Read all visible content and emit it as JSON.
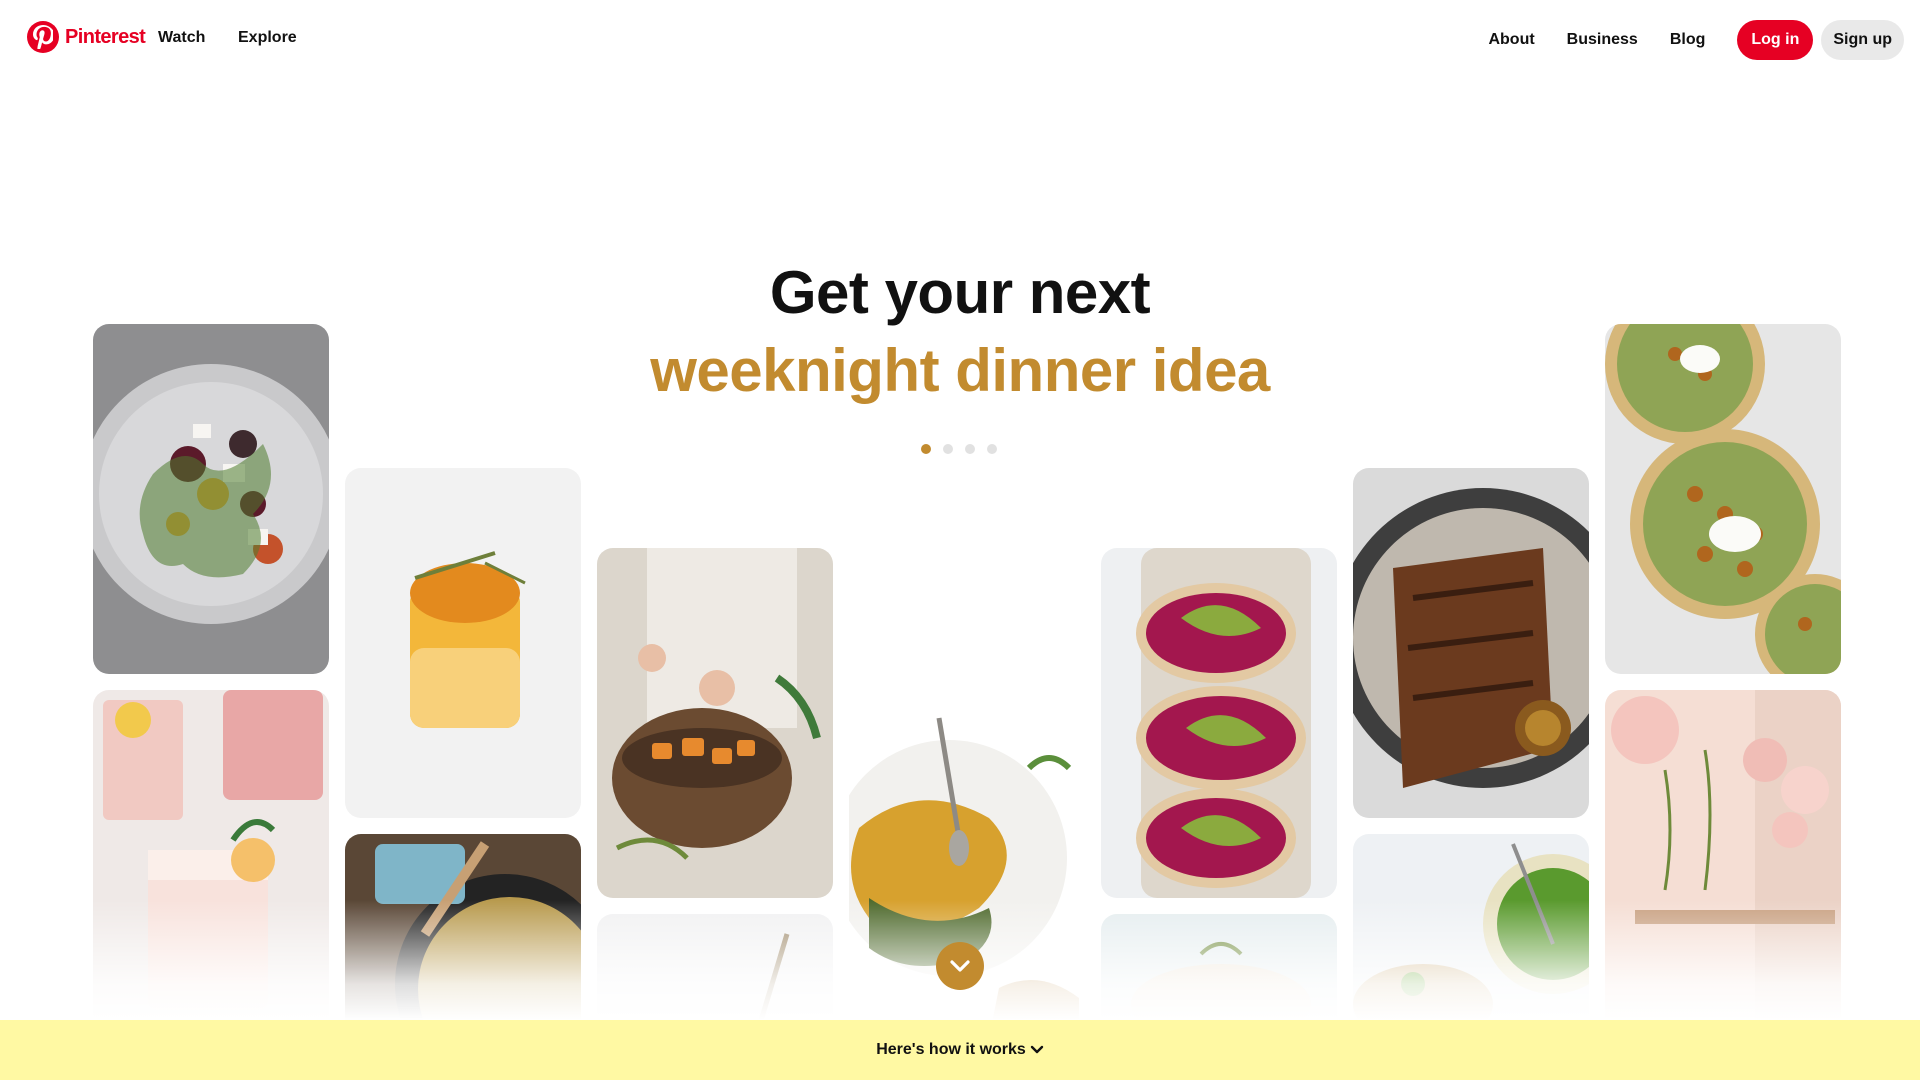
{
  "brand": {
    "name": "Pinterest",
    "color": "#E60023"
  },
  "nav": {
    "left": [
      {
        "label": "Watch"
      },
      {
        "label": "Explore"
      }
    ],
    "right": [
      {
        "label": "About"
      },
      {
        "label": "Business"
      },
      {
        "label": "Blog"
      }
    ],
    "login_label": "Log in",
    "signup_label": "Sign up"
  },
  "hero": {
    "line1": "Get your next",
    "line2": "weeknight dinner idea",
    "accent_color": "#C28B2F",
    "carousel_pages": 4,
    "active_page": 1
  },
  "pins": [
    {
      "subject": "beet salad plate"
    },
    {
      "subject": "pink lemonade glass"
    },
    {
      "subject": "citrus drink with thyme"
    },
    {
      "subject": "frittata in cast iron pan"
    },
    {
      "subject": "hands seasoning roasted squash bowl"
    },
    {
      "subject": "cocktail with spoon"
    },
    {
      "subject": "hummus bowl with pumpkin seeds"
    },
    {
      "subject": "beet hummus avocado toast"
    },
    {
      "subject": "wrap sandwich"
    },
    {
      "subject": "blackened chicken with lemon"
    },
    {
      "subject": "peas and toast"
    },
    {
      "subject": "chickpea flatbreads"
    },
    {
      "subject": "pastel party room with balloons"
    }
  ],
  "bottom_bar": {
    "label": "Here's how it works",
    "color": "#FFF9A3"
  }
}
